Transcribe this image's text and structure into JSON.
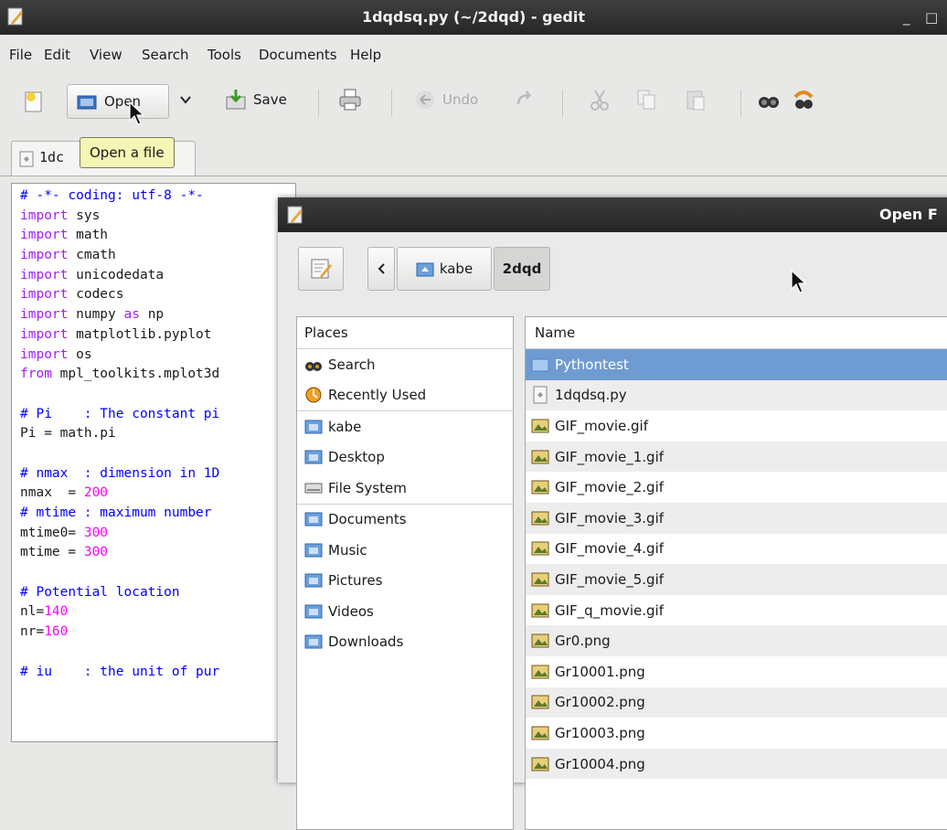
{
  "window": {
    "title": "1dqdsq.py (~/2dqd) - gedit",
    "minimize": "_",
    "maximize": "□",
    "close": "×"
  },
  "menu": [
    "File",
    "Edit",
    "View",
    "Search",
    "Tools",
    "Documents",
    "Help"
  ],
  "toolbar": {
    "open_label": "Open",
    "save_label": "Save",
    "undo_label": "Undo"
  },
  "tab": {
    "label": "1dc"
  },
  "tooltip": {
    "text": "Open a file"
  },
  "editor": {
    "lines": [
      [
        [
          "cm",
          "# -*- coding: utf-8 -*-"
        ]
      ],
      [
        [
          "kw",
          "import"
        ],
        [
          "",
          "sys"
        ]
      ],
      [
        [
          "kw",
          "import"
        ],
        [
          "",
          "math"
        ]
      ],
      [
        [
          "kw",
          "import"
        ],
        [
          "",
          "cmath"
        ]
      ],
      [
        [
          "kw",
          "import"
        ],
        [
          "",
          "unicodedata"
        ]
      ],
      [
        [
          "kw",
          "import"
        ],
        [
          "",
          "codecs"
        ]
      ],
      [
        [
          "kw",
          "import"
        ],
        [
          "",
          "numpy "
        ],
        [
          "kw",
          "as"
        ],
        [
          "",
          "np"
        ]
      ],
      [
        [
          "kw",
          "import"
        ],
        [
          "",
          "matplotlib.pyplot"
        ]
      ],
      [
        [
          "kw",
          "import"
        ],
        [
          "",
          "os"
        ]
      ],
      [
        [
          "kw",
          "from"
        ],
        [
          "",
          "mpl_toolkits.mplot3d"
        ]
      ],
      [],
      [
        [
          "cm",
          "# Pi    : The constant pi"
        ]
      ],
      [
        [
          "",
          "Pi = math.pi"
        ]
      ],
      [],
      [
        [
          "cm",
          "# nmax  : dimension in 1D"
        ]
      ],
      [
        [
          "",
          "nmax  = "
        ],
        [
          "nm",
          "200"
        ]
      ],
      [
        [
          "cm",
          "# mtime : maximum number"
        ]
      ],
      [
        [
          "",
          "mtime0= "
        ],
        [
          "nm",
          "300"
        ]
      ],
      [
        [
          "",
          "mtime = "
        ],
        [
          "nm",
          "300"
        ]
      ],
      [],
      [
        [
          "cm",
          "# Potential location"
        ]
      ],
      [
        [
          "",
          "nl="
        ],
        [
          "nm",
          "140"
        ]
      ],
      [
        [
          "",
          "nr="
        ],
        [
          "nm",
          "160"
        ]
      ],
      [],
      [
        [
          "cm",
          "# iu    : the unit of pur"
        ]
      ]
    ]
  },
  "dialog": {
    "title": "Open F",
    "path": [
      "kabe",
      "2dqd"
    ],
    "places_header": "Places",
    "places": [
      {
        "label": "Search",
        "icon": "binoculars-icon"
      },
      {
        "label": "Recently Used",
        "icon": "recent-icon"
      },
      {
        "label": "kabe",
        "icon": "home-folder-icon"
      },
      {
        "label": "Desktop",
        "icon": "desktop-folder-icon"
      },
      {
        "label": "File System",
        "icon": "drive-icon"
      },
      {
        "label": "Documents",
        "icon": "documents-folder-icon"
      },
      {
        "label": "Music",
        "icon": "music-folder-icon"
      },
      {
        "label": "Pictures",
        "icon": "pictures-folder-icon"
      },
      {
        "label": "Videos",
        "icon": "videos-folder-icon"
      },
      {
        "label": "Downloads",
        "icon": "downloads-folder-icon"
      }
    ],
    "files_header": "Name",
    "files": [
      {
        "name": "Pythontest",
        "type": "folder"
      },
      {
        "name": "1dqdsq.py",
        "type": "text"
      },
      {
        "name": "GIF_movie.gif",
        "type": "image"
      },
      {
        "name": "GIF_movie_1.gif",
        "type": "image"
      },
      {
        "name": "GIF_movie_2.gif",
        "type": "image"
      },
      {
        "name": "GIF_movie_3.gif",
        "type": "image"
      },
      {
        "name": "GIF_movie_4.gif",
        "type": "image"
      },
      {
        "name": "GIF_movie_5.gif",
        "type": "image"
      },
      {
        "name": "GIF_q_movie.gif",
        "type": "image"
      },
      {
        "name": "Gr0.png",
        "type": "image"
      },
      {
        "name": "Gr10001.png",
        "type": "image"
      },
      {
        "name": "Gr10002.png",
        "type": "image"
      },
      {
        "name": "Gr10003.png",
        "type": "image"
      },
      {
        "name": "Gr10004.png",
        "type": "image"
      }
    ],
    "selected_index": 0
  }
}
